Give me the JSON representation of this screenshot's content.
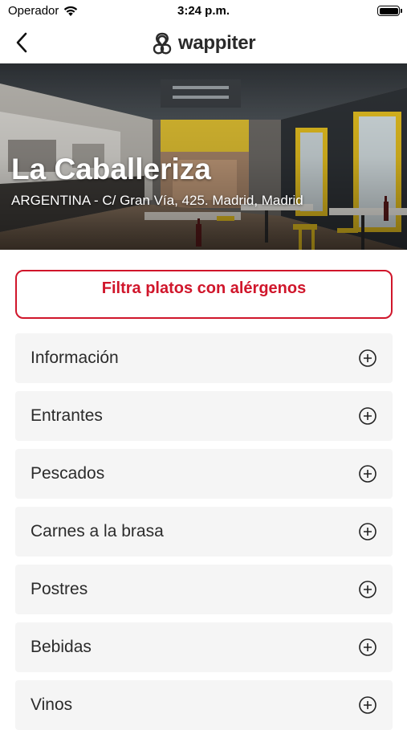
{
  "status_bar": {
    "carrier": "Operador",
    "time": "3:24 p.m."
  },
  "nav": {
    "back_icon": "chevron-left-icon",
    "logo_text": "wappiter"
  },
  "restaurant": {
    "name": "La Caballeriza",
    "address": "ARGENTINA - C/ Gran Vía, 425. Madrid, Madrid"
  },
  "filter": {
    "label": "Filtra platos con alérgenos",
    "accent_color": "#d0162b"
  },
  "sections": [
    {
      "label": "Información",
      "icon": "plus-circle-icon"
    },
    {
      "label": "Entrantes",
      "icon": "plus-circle-icon"
    },
    {
      "label": "Pescados",
      "icon": "plus-circle-icon"
    },
    {
      "label": "Carnes a la brasa",
      "icon": "plus-circle-icon"
    },
    {
      "label": "Postres",
      "icon": "plus-circle-icon"
    },
    {
      "label": "Bebidas",
      "icon": "plus-circle-icon"
    },
    {
      "label": "Vinos",
      "icon": "plus-circle-icon"
    }
  ]
}
